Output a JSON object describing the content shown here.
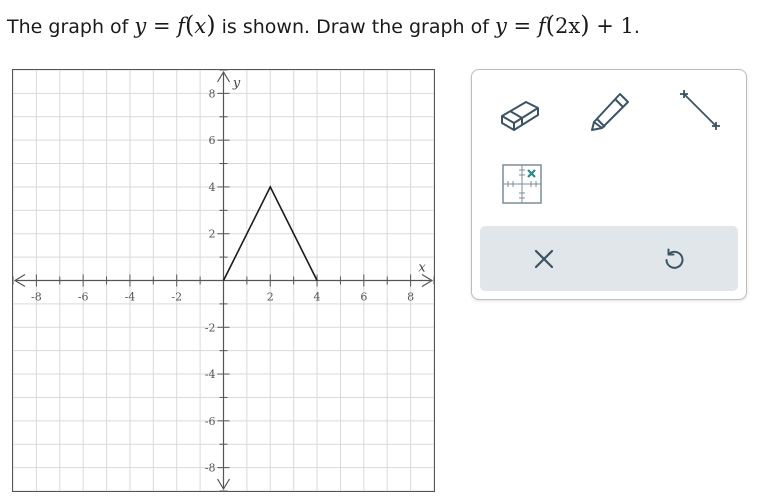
{
  "question": {
    "lead": "The graph of ",
    "eq1_lhs": "y",
    "eq1_eq": " = ",
    "eq1_f": "f",
    "eq1_arg": "x",
    "middle": " is shown. Draw the graph of ",
    "eq2_lhs": "y",
    "eq2_eq": " = ",
    "eq2_f": "f",
    "eq2_arg": "2x",
    "eq2_tail": " + 1",
    "end": "."
  },
  "graph": {
    "x_axis_label": "x",
    "y_axis_label": "y",
    "x_ticks": [
      "-8",
      "-6",
      "-4",
      "-2",
      "2",
      "4",
      "6",
      "8"
    ],
    "y_ticks": [
      "8",
      "6",
      "4",
      "2",
      "-2",
      "-4",
      "-6",
      "-8"
    ]
  },
  "chart_data": {
    "type": "line",
    "xlabel": "x",
    "ylabel": "y",
    "xlim": [
      -9,
      9
    ],
    "ylim": [
      -9,
      9
    ],
    "grid": true,
    "tick_step": 2,
    "minor_step": 1,
    "series": [
      {
        "x": [
          0,
          2,
          4
        ],
        "y": [
          0,
          4,
          0
        ]
      }
    ]
  },
  "toolbox": {
    "tools": [
      {
        "icon": "eraser-icon"
      },
      {
        "icon": "pencil-icon"
      },
      {
        "icon": "line-segment-icon"
      },
      {
        "icon": "graph-point-icon"
      }
    ],
    "actions": [
      {
        "icon": "close-icon"
      },
      {
        "icon": "undo-icon"
      }
    ],
    "accent": "#2a8a8a",
    "icon_color": "#3a5463"
  }
}
